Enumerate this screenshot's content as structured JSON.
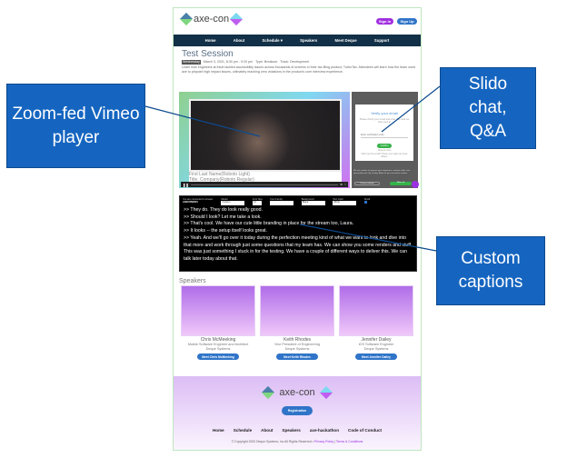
{
  "header": {
    "logo_text": "axe-con",
    "signin": "Sign In",
    "signup": "Sign Up"
  },
  "nav": [
    "Home",
    "About",
    "Schedule ▾",
    "Speakers",
    "Meet Deque",
    "Support"
  ],
  "session": {
    "title": "Test Session",
    "day": "Wednesday",
    "datetime": "March 3, 2021, 8:30 pm - 9:20 pm",
    "type": "Type: Breakout",
    "track": "Track: Development",
    "description": "Learn how engineers at Intuit tackled accessibility issues across thousands of screens in their tax-filing product, TurboTax. Attendees will learn how the team used axe to pinpoint high impact issues, ultimately reaching zero violations in the product's core interview experience."
  },
  "video": {
    "name_line": "First Last Name(Roboto Light)",
    "title_line": "Title, Company(Roboto Regular)"
  },
  "slido": {
    "heading": "Verify your email",
    "body": "Please check your email and enter the code we have sent to",
    "placeholder": "Enter verification code",
    "confirm": "Confirm",
    "resend": "Resend code",
    "help": "Didn't get the email? Check your spam and junk folders.",
    "cookie": "We use cookies to improve your experience, analyze traffic, and personalize ads. By clicking 'Allow all' you consent to cookies.",
    "privacy_settings": "Privacy settings",
    "allow_all": "Allow all"
  },
  "captions": {
    "connected": "You are connected to stream:",
    "stream": "AXECON2021",
    "controls": [
      {
        "label": "Model",
        "value": "Custom"
      },
      {
        "label": "Font Size",
        "value": "12"
      },
      {
        "label": "Font Family",
        "value": ""
      },
      {
        "label": "Background",
        "value": "Black"
      },
      {
        "label": "Text Color",
        "value": "White"
      }
    ],
    "scroll_label": "Scroll",
    "lines": [
      ">> They do.  They do look really good.",
      ">> Should I look?  Let me take a look.",
      ">> That's cool.  We have our cute little branding in place for the stream too, Laura.",
      ">> It looks -- the setup itself looks great.",
      ">> Yeah.  And we'll go over it today during the perfection meeting kind of what we want to look and dive into that more and work through just some questions that my team has.  We can show you some renders and stuff.  This was just something I stuck in for the testing.  We have a couple of different ways to deliver this.  We can talk later today about that."
    ]
  },
  "speakers": {
    "heading": "Speakers",
    "items": [
      {
        "name": "Chris McMeeking",
        "role": "Mobile Software Engineer and Architect",
        "company": "Deque Systems",
        "button": "Meet Chris McMeeking"
      },
      {
        "name": "Keith Rhodes",
        "role": "Vice President of Engineering",
        "company": "Deque Systems",
        "button": "Meet Keith Rhodes"
      },
      {
        "name": "Jennifer Dailey",
        "role": "iOS Software Engineer",
        "company": "Deque Systems",
        "button": "Meet Jennifer Dailey"
      }
    ]
  },
  "footer": {
    "logo_text": "axe-con",
    "registration": "Registration",
    "links": [
      "Home",
      "Schedule",
      "About",
      "Speakers",
      "axe-hackathon",
      "Code of Conduct"
    ],
    "copyright": "© Copyright 2020 Deque Systems, Inc All Rights Reserved  •",
    "privacy": "Privacy Policy",
    "separator": "|",
    "terms": "Terms & Conditions"
  },
  "callouts": {
    "video": "Zoom-fed Vimeo player",
    "slido": "Slido chat, Q&A",
    "captions": "Custom captions"
  },
  "colors": {
    "nav": "#123047",
    "accent_purple": "#9b30e0",
    "accent_blue": "#2f74c8",
    "callout": "#1565c0"
  }
}
